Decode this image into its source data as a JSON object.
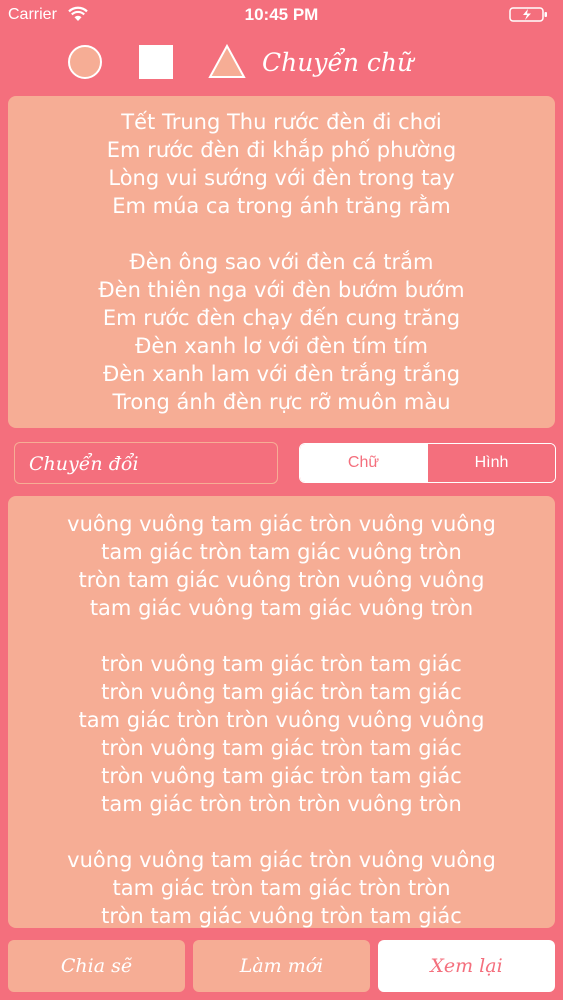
{
  "status_bar": {
    "carrier": "Carrier",
    "time": "10:45 PM"
  },
  "toolbar": {
    "shapes": [
      "circle-icon",
      "square-icon",
      "triangle-icon"
    ],
    "mode_title": "Chuyển chữ"
  },
  "source_text": {
    "lines": [
      "Tết Trung Thu rước đèn đi chơi",
      "Em rước đèn đi khắp phố phường",
      "Lòng vui sướng với đèn trong tay",
      "Em múa ca trong ánh trăng rằm",
      "",
      "Đèn ông sao với đèn cá trắm",
      "Đèn thiên nga với đèn bướm bướm",
      "Em rước đèn chạy đến cung trăng",
      "Đèn xanh lơ với đèn tím tím",
      "Đèn xanh lam với đèn trắng trắng",
      "Trong ánh đèn rực rỡ muôn màu"
    ]
  },
  "convert": {
    "input_label": "Chuyển đổi",
    "segments": [
      "Chữ",
      "Hình"
    ],
    "selected": "Chữ"
  },
  "result_text": {
    "lines": [
      "vuông vuông tam giác tròn vuông vuông",
      "tam giác tròn tam giác vuông tròn",
      "tròn tam giác vuông tròn vuông vuông",
      "tam giác vuông tam giác vuông tròn",
      "",
      "tròn vuông tam giác tròn tam giác",
      "tròn vuông tam giác tròn tam giác",
      "tam giác tròn tròn vuông vuông vuông",
      "tròn vuông tam giác tròn tam giác",
      "tròn vuông tam giác tròn tam giác",
      "tam giác tròn tròn tròn vuông tròn",
      "",
      "vuông vuông tam giác tròn vuông vuông",
      "tam giác tròn tam giác tròn tròn",
      "tròn tam giác vuông tròn tam giác"
    ]
  },
  "buttons": {
    "share": "Chia sẽ",
    "reset": "Làm mới",
    "review": "Xem lại"
  },
  "colors": {
    "background": "#f46f7d",
    "panel": "#f6ad95",
    "text": "#ffffff"
  }
}
